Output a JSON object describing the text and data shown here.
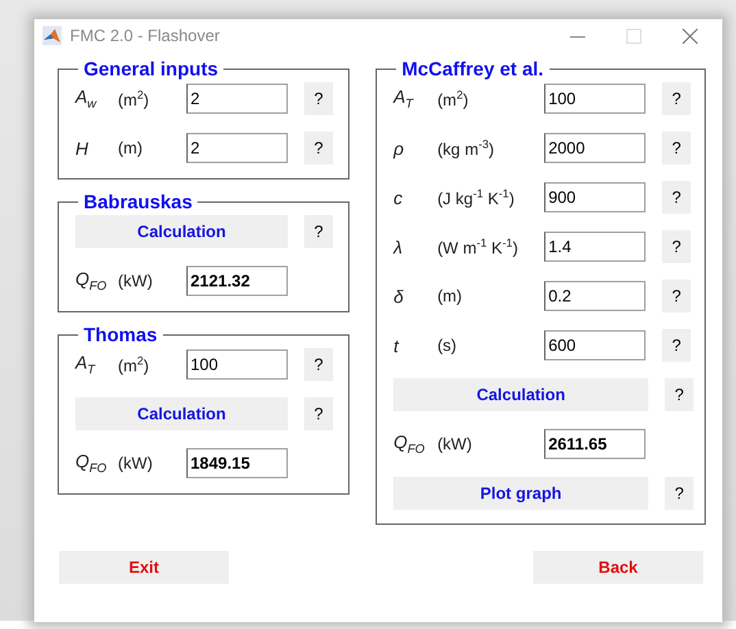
{
  "window": {
    "title": "FMC 2.0 - Flashover"
  },
  "left_column": [
    {
      "title": "General inputs",
      "rows": [
        {
          "kind": "input",
          "symbol": "A$_{w}$",
          "unit": "(m$^{2}$)",
          "value": "2",
          "help": "?"
        },
        {
          "kind": "input",
          "symbol": "H",
          "unit": "(m)",
          "value": "2",
          "help": "?"
        }
      ]
    },
    {
      "title": "Babrauskas",
      "rows": [
        {
          "kind": "button",
          "label": "Calculation",
          "help": "?"
        },
        {
          "kind": "output",
          "symbol": "Q$_{FO}$",
          "unit": "(kW)",
          "value": "2121.32"
        }
      ]
    },
    {
      "title": "Thomas",
      "rows": [
        {
          "kind": "input",
          "symbol": "A$_{T}$",
          "unit": "(m$^{2}$)",
          "value": "100",
          "help": "?"
        },
        {
          "kind": "button",
          "label": "Calculation",
          "help": "?"
        },
        {
          "kind": "output",
          "symbol": "Q$_{FO}$",
          "unit": "(kW)",
          "value": "1849.15"
        }
      ]
    }
  ],
  "right_column": [
    {
      "title": "McCaffrey et al.",
      "rows": [
        {
          "kind": "input",
          "symbol": "A$_{T}$",
          "unit": "(m$^{2}$)",
          "value": "100",
          "help": "?"
        },
        {
          "kind": "input",
          "symbol": "ρ",
          "unit": "(kg m$^{-3}$)",
          "value": "2000",
          "help": "?"
        },
        {
          "kind": "input",
          "symbol": "c",
          "unit": "(J kg$^{-1}$ K$^{-1}$)",
          "value": "900",
          "help": "?"
        },
        {
          "kind": "input",
          "symbol": "λ",
          "unit": "(W m$^{-1}$ K$^{-1}$)",
          "value": "1.4",
          "help": "?"
        },
        {
          "kind": "input",
          "symbol": "δ",
          "unit": "(m)",
          "value": "0.2",
          "help": "?"
        },
        {
          "kind": "input",
          "symbol": "t",
          "unit": "(s)",
          "value": "600",
          "help": "?"
        },
        {
          "kind": "button",
          "label": "Calculation",
          "help": "?"
        },
        {
          "kind": "output",
          "symbol": "Q$_{FO}$",
          "unit": "(kW)",
          "value": "2611.65"
        },
        {
          "kind": "button",
          "label": "Plot graph",
          "help": "?"
        }
      ]
    }
  ],
  "footer_buttons": [
    {
      "label": "Exit"
    },
    {
      "label": "Back"
    }
  ]
}
